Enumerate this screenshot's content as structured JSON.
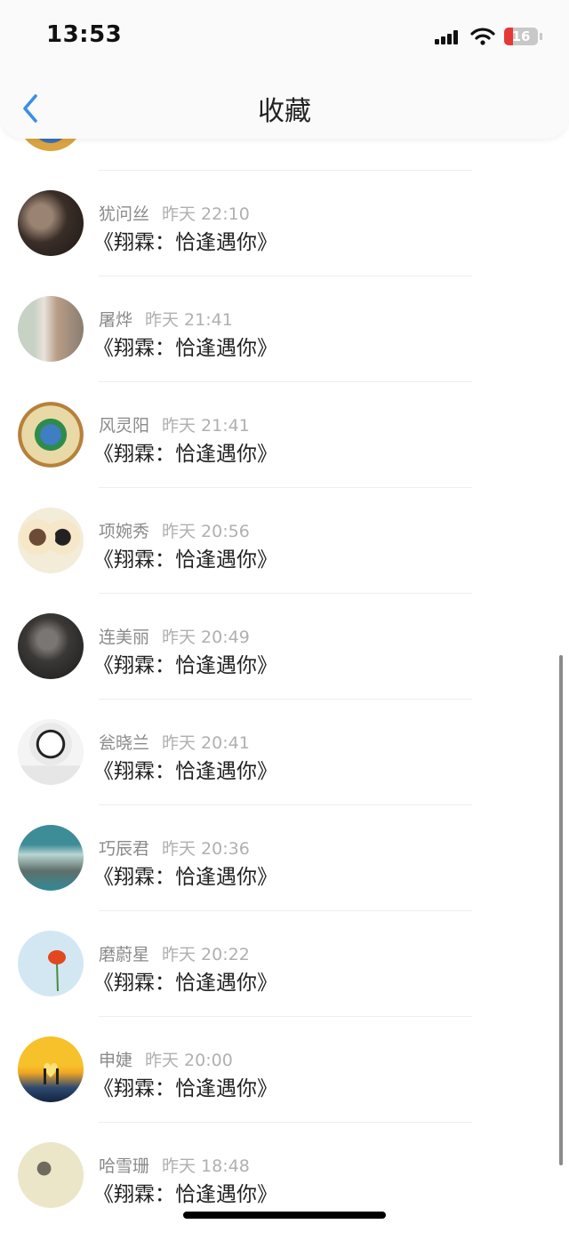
{
  "status_bar": {
    "time": "13:53",
    "battery": "16"
  },
  "nav": {
    "title": "收藏"
  },
  "items": [
    {
      "name": "犹问丝",
      "time": "昨天 22:10",
      "title": "《翔霖：恰逢遇你》"
    },
    {
      "name": "屠烨",
      "time": "昨天 21:41",
      "title": "《翔霖：恰逢遇你》"
    },
    {
      "name": "风灵阳",
      "time": "昨天 21:41",
      "title": "《翔霖：恰逢遇你》"
    },
    {
      "name": "项婉秀",
      "time": "昨天 20:56",
      "title": "《翔霖：恰逢遇你》"
    },
    {
      "name": "连美丽",
      "time": "昨天 20:49",
      "title": "《翔霖：恰逢遇你》"
    },
    {
      "name": "瓮晓兰",
      "time": "昨天 20:41",
      "title": "《翔霖：恰逢遇你》"
    },
    {
      "name": "巧辰君",
      "time": "昨天 20:36",
      "title": "《翔霖：恰逢遇你》"
    },
    {
      "name": "磨蔚星",
      "time": "昨天 20:22",
      "title": "《翔霖：恰逢遇你》"
    },
    {
      "name": "申婕",
      "time": "昨天 20:00",
      "title": "《翔霖：恰逢遇你》"
    },
    {
      "name": "哈雪珊",
      "time": "昨天 18:48",
      "title": "《翔霖：恰逢遇你》"
    }
  ]
}
